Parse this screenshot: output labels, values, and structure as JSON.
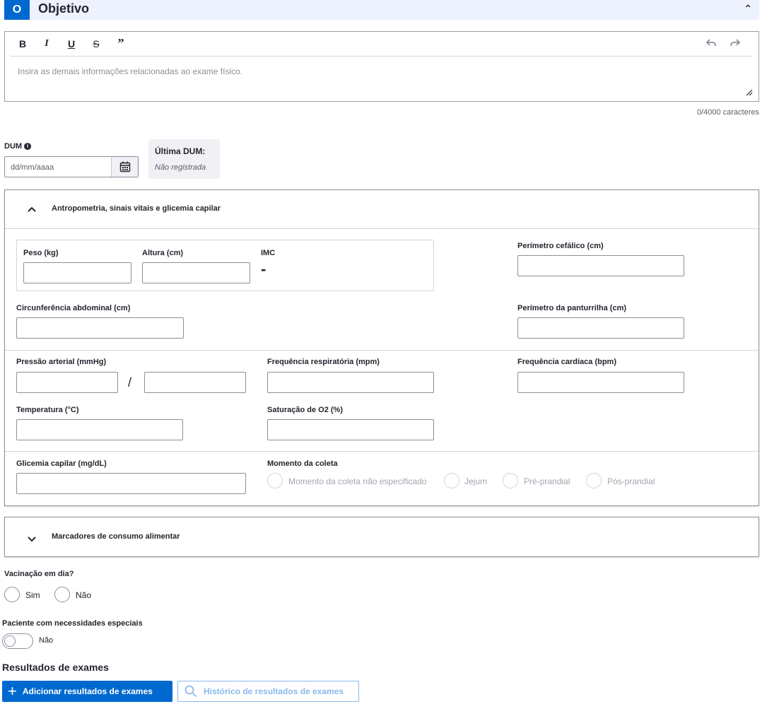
{
  "header": {
    "badge": "O",
    "title": "Objetivo",
    "collapse_icon": "chevron-up-icon"
  },
  "editor": {
    "toolbar": {
      "bold": "B",
      "italic": "I",
      "underline": "U",
      "strike": "S",
      "quote": "”"
    },
    "placeholder": "Insira as demais informações relacionadas ao exame físico.",
    "char_count": "0/4000 caracteres"
  },
  "dum": {
    "label": "DUM",
    "placeholder": "dd/mm/aaaa",
    "last_title": "Última DUM:",
    "last_value": "Não registrada"
  },
  "antropometria": {
    "title": "Antropometria, sinais vitais e glicemia capilar",
    "peso": "Peso (kg)",
    "altura": "Altura (cm)",
    "imc": "IMC",
    "imc_value": "-",
    "perimetro_cefalico": "Perímetro cefálico (cm)",
    "circunferencia": "Circunferência abdominal (cm)",
    "panturrilha": "Perímetro da panturrilha (cm)",
    "pressao": "Pressão arterial (mmHg)",
    "pressao_sep": "/",
    "freq_resp": "Frequência respiratória (mpm)",
    "freq_card": "Frequência cardíaca (bpm)",
    "temperatura": "Temperatura (°C)",
    "saturacao": "Saturação de O2 (%)",
    "glicemia": "Glicemia capilar (mg/dL)",
    "momento": "Momento da coleta",
    "momento_options": [
      "Momento da coleta não especificado",
      "Jejum",
      "Pré-prandial",
      "Pós-prandial"
    ]
  },
  "marcadores": {
    "title": "Marcadores de consumo alimentar"
  },
  "vacinacao": {
    "label": "Vacinação em dia?",
    "options": [
      "Sim",
      "Não"
    ]
  },
  "necessidades": {
    "label": "Paciente com necessidades especiais",
    "toggle_text": "Não",
    "checked": false
  },
  "resultados": {
    "title": "Resultados de exames",
    "add_button": "Adicionar resultados de exames",
    "history_button": "Histórico de resultados de exames"
  }
}
